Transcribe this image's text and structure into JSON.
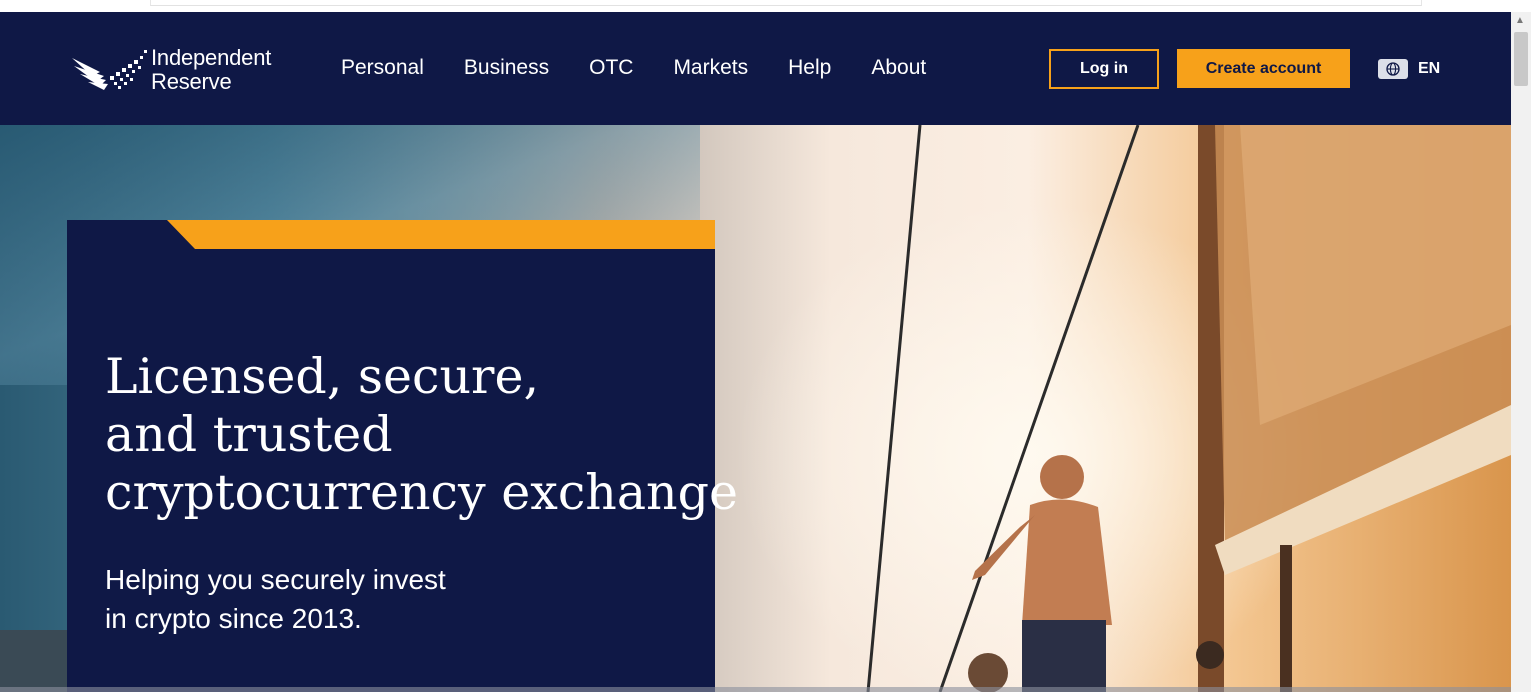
{
  "brand": {
    "name_line1": "Independent",
    "name_line2": "Reserve"
  },
  "nav": {
    "items": [
      "Personal",
      "Business",
      "OTC",
      "Markets",
      "Help",
      "About"
    ]
  },
  "actions": {
    "login_label": "Log in",
    "create_label": "Create account"
  },
  "language": {
    "code": "EN",
    "icon": "globe-icon"
  },
  "hero": {
    "headline_lines": [
      "Licensed, secure,",
      "and trusted",
      "cryptocurrency exchange"
    ],
    "subline_lines": [
      "Helping you securely invest",
      "in crypto since 2013."
    ]
  },
  "colors": {
    "navy": "#0f1846",
    "accent_orange": "#f7a11a"
  }
}
